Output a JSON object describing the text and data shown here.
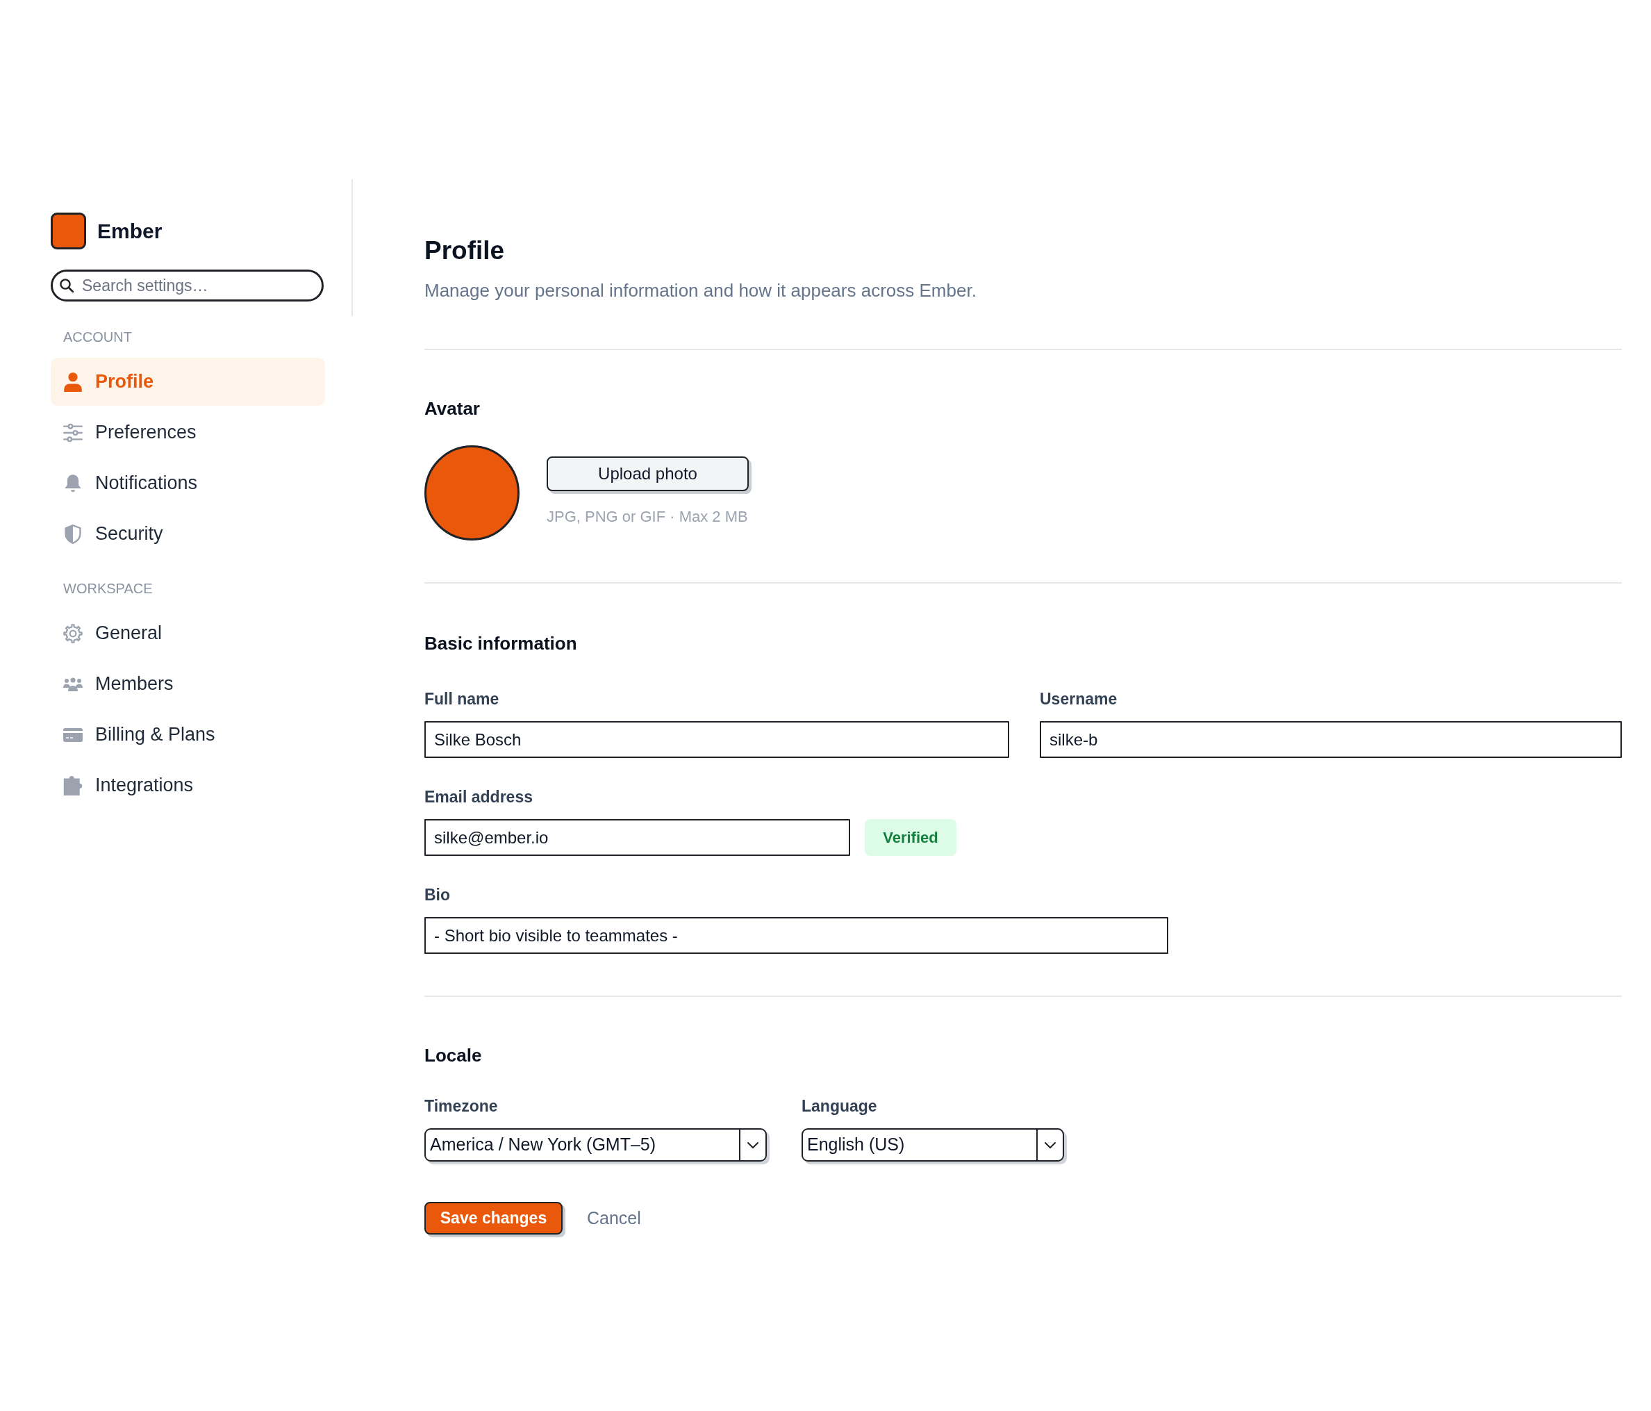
{
  "sidebar": {
    "brand": "Ember",
    "search": {
      "placeholder": "Search settings…"
    },
    "sections": [
      {
        "heading": "ACCOUNT",
        "items": [
          {
            "label": "Profile",
            "selected": true
          },
          {
            "label": "Preferences",
            "selected": false
          },
          {
            "label": "Notifications",
            "selected": false
          },
          {
            "label": "Security",
            "selected": false
          }
        ]
      },
      {
        "heading": "WORKSPACE",
        "items": [
          {
            "label": "General",
            "selected": false
          },
          {
            "label": "Members",
            "selected": false
          },
          {
            "label": "Billing & Plans",
            "selected": false
          },
          {
            "label": "Integrations",
            "selected": false
          }
        ]
      }
    ]
  },
  "header": {
    "title": "Profile",
    "subtitle": "Manage your personal information and how it appears across Ember."
  },
  "avatar": {
    "heading": "Avatar",
    "button": "Upload photo",
    "hint": "JPG, PNG or GIF · Max 2 MB"
  },
  "basic_information": {
    "heading": "Basic information",
    "fields": [
      {
        "label": "Full name",
        "value": "Silke Bosch"
      },
      {
        "label": "Username",
        "value": "silke-b"
      },
      {
        "label": "Email address",
        "value": "silke@ember.io",
        "status": "Verified"
      },
      {
        "label": "Bio",
        "value": "- Short bio visible to teammates -"
      }
    ]
  },
  "locale": {
    "heading": "Locale",
    "fields": [
      {
        "label": "Timezone",
        "value": "America / New York (GMT–5)"
      },
      {
        "label": "Language",
        "value": "English (US)"
      }
    ]
  },
  "actions": [
    {
      "label": "Save changes",
      "kind": "primary"
    },
    {
      "label": "Cancel",
      "kind": "link"
    }
  ]
}
